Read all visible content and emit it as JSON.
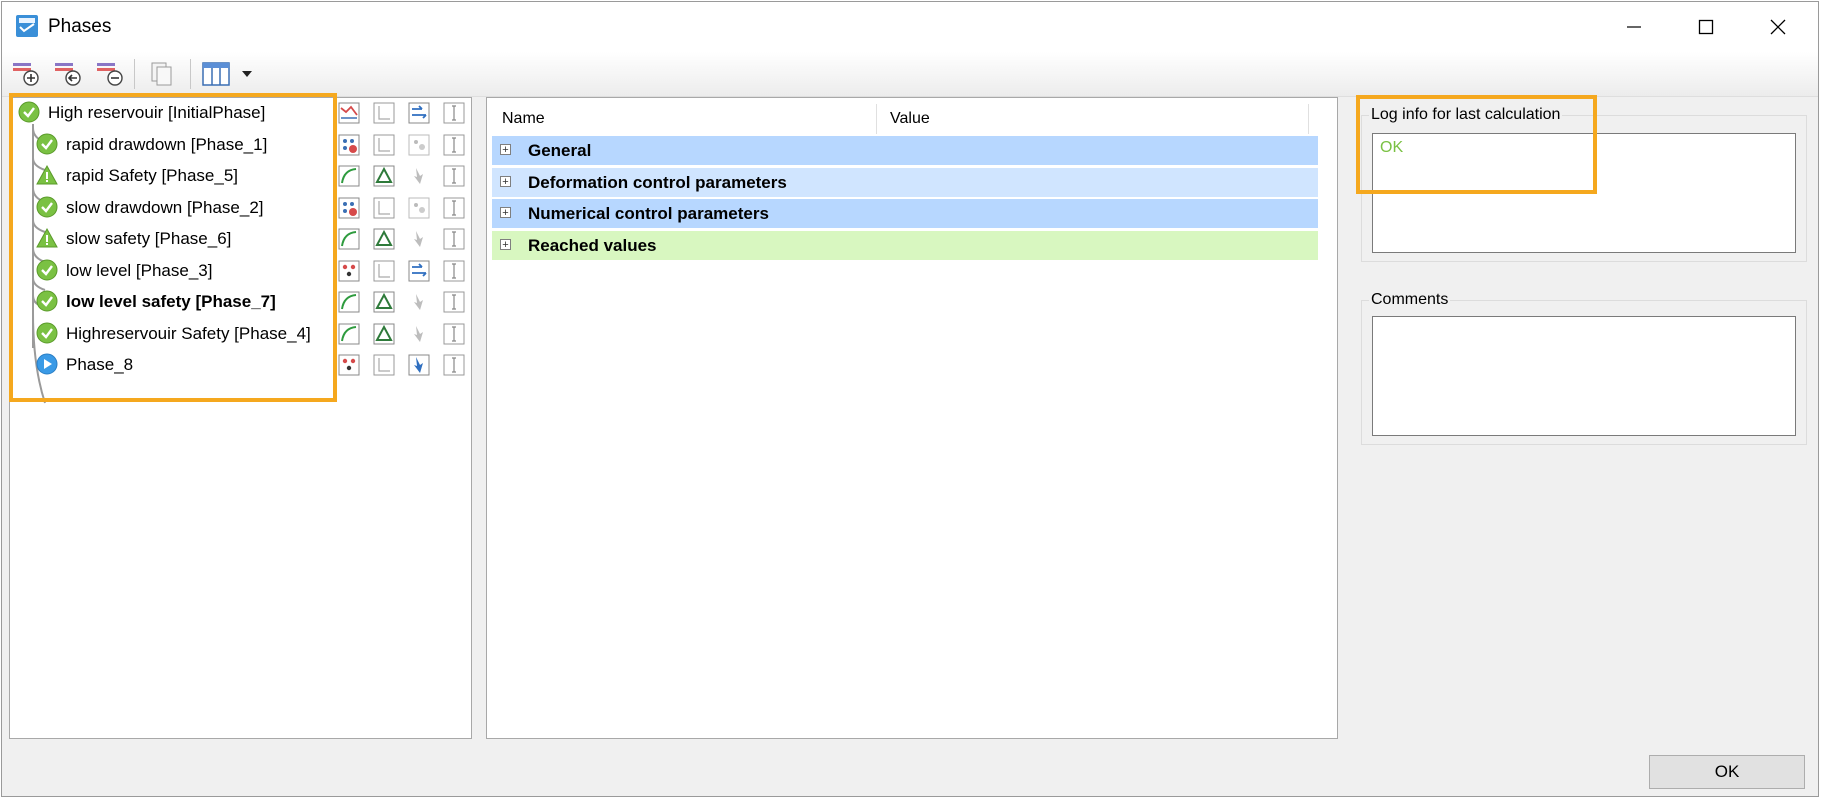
{
  "window": {
    "title": "Phases"
  },
  "toolbar": {
    "buttons": [
      {
        "icon": "add-phase-icon"
      },
      {
        "icon": "insert-phase-icon"
      },
      {
        "icon": "delete-phase-icon"
      },
      {
        "icon": "copy-icon"
      },
      {
        "icon": "columns-icon"
      }
    ]
  },
  "phases": [
    {
      "label": "High reservouir [InitialPhase]",
      "status": "ok",
      "bold": false
    },
    {
      "label": "rapid drawdown [Phase_1]",
      "status": "ok",
      "bold": false
    },
    {
      "label": "rapid Safety [Phase_5]",
      "status": "warning",
      "bold": false
    },
    {
      "label": "slow drawdown [Phase_2]",
      "status": "ok",
      "bold": false
    },
    {
      "label": "slow safety [Phase_6]",
      "status": "warning",
      "bold": false
    },
    {
      "label": "low level [Phase_3]",
      "status": "ok",
      "bold": false
    },
    {
      "label": "low level safety [Phase_7]",
      "status": "ok",
      "bold": true
    },
    {
      "label": "Highreservouir Safety [Phase_4]",
      "status": "ok",
      "bold": false
    },
    {
      "label": "Phase_8",
      "status": "pending",
      "bold": false
    }
  ],
  "params_table": {
    "col_name": "Name",
    "col_value": "Value",
    "groups": [
      {
        "label": "General",
        "color": "#b7d7ff"
      },
      {
        "label": "Deformation control parameters",
        "color": "#d0e5ff"
      },
      {
        "label": "Numerical control parameters",
        "color": "#b7d7ff"
      },
      {
        "label": "Reached values",
        "color": "#d8f7c0"
      }
    ]
  },
  "log": {
    "title": "Log info for last calculation",
    "text": "OK",
    "text_color": "#7ac143"
  },
  "comments": {
    "title": "Comments",
    "text": ""
  },
  "ok_button": "OK",
  "colors": {
    "highlight": "#f5a81e",
    "ok_green": "#7ac143"
  }
}
